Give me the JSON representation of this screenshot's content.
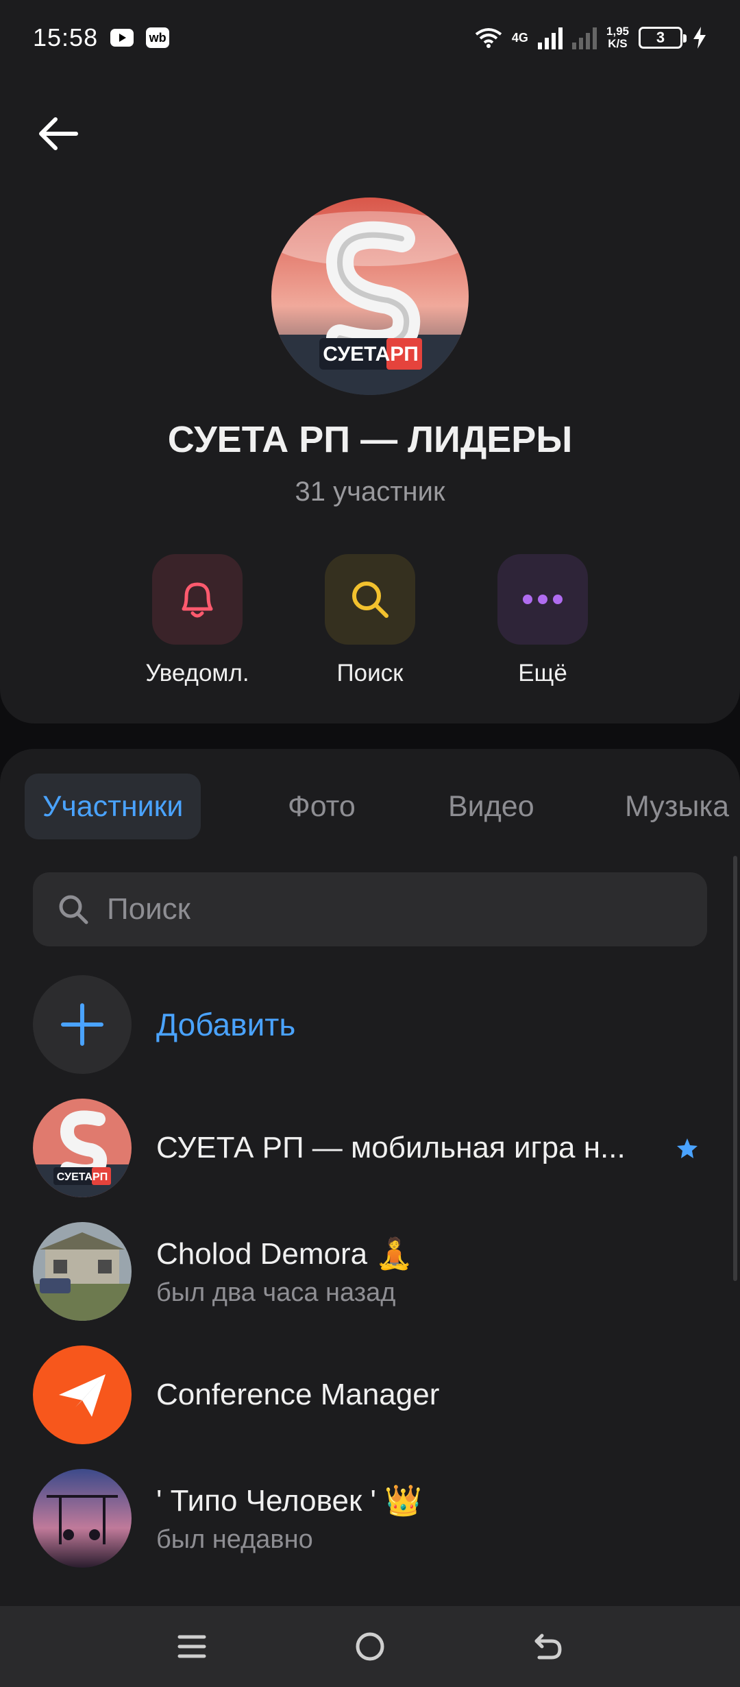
{
  "status_bar": {
    "time": "15:58",
    "app_icons": [
      "youtube-icon",
      "wb-icon"
    ],
    "wb_label": "wb",
    "network_type": "4G",
    "speed_value": "1,95",
    "speed_unit": "K/S",
    "battery_level": "3"
  },
  "header": {
    "back_icon": "arrow-left-icon",
    "group_title": "СУЕТА РП — ЛИДЕРЫ",
    "member_count": "31 участник",
    "avatar_text": "СУЕТАРП",
    "actions": [
      {
        "label": "Уведомл.",
        "icon": "bell-icon",
        "color": "#ff5a6e"
      },
      {
        "label": "Поиск",
        "icon": "search-icon",
        "color": "#f2c12e"
      },
      {
        "label": "Ещё",
        "icon": "more-dots-icon",
        "color": "#b06cf0"
      }
    ]
  },
  "tabs": [
    {
      "label": "Участники",
      "active": true
    },
    {
      "label": "Фото",
      "active": false
    },
    {
      "label": "Видео",
      "active": false
    },
    {
      "label": "Музыка",
      "active": false
    }
  ],
  "search": {
    "placeholder": "Поиск"
  },
  "add_member": {
    "label": "Добавить"
  },
  "members": [
    {
      "name": "СУЕТА РП — мобильная игра н...",
      "status": "",
      "admin_star": true
    },
    {
      "name": "Cholod Demora 🧘",
      "status": "был два часа назад"
    },
    {
      "name": "Conference Manager",
      "status": ""
    },
    {
      "name": "' Типо Человек ' 👑",
      "status": "был недавно"
    }
  ],
  "colors": {
    "accent": "#4aa3ff",
    "card_bg": "#1c1c1e",
    "page_bg": "#0d0d0f"
  }
}
